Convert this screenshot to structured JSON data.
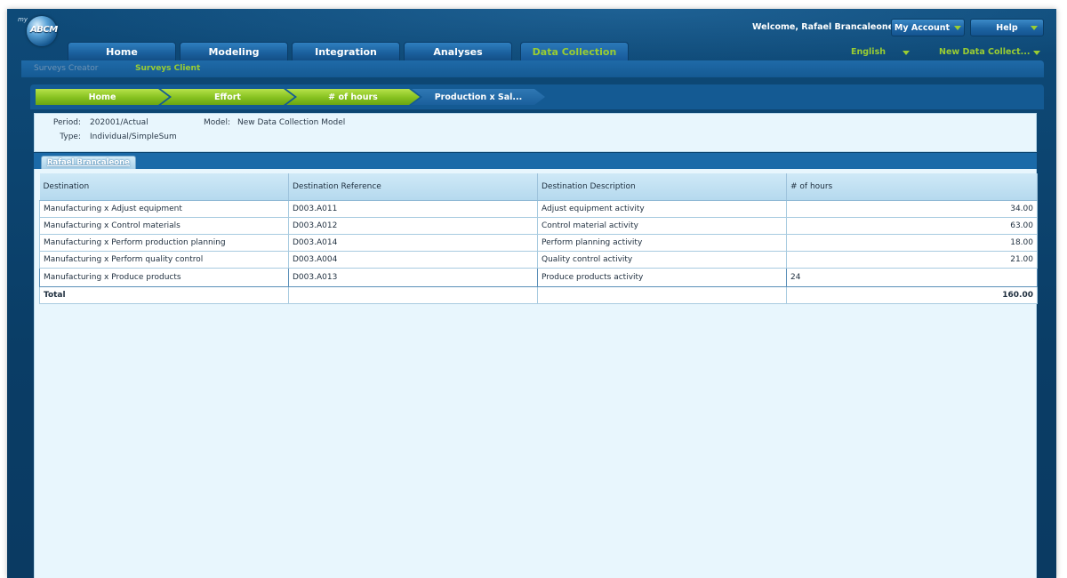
{
  "header": {
    "logo_prefix": "my",
    "logo_text": "ABCM",
    "welcome": "Welcome, Rafael Brancaleone",
    "my_account": "My Account",
    "help": "Help",
    "language": "English",
    "model_select": "New Data Collect..."
  },
  "nav": {
    "tabs": [
      "Home",
      "Modeling",
      "Integration",
      "Analyses",
      "Data Collection"
    ],
    "active": "Data Collection"
  },
  "subnav": {
    "items": [
      "Surveys Creator",
      "Surveys Client"
    ],
    "active": "Surveys Client"
  },
  "breadcrumb": [
    "Home",
    "Effort",
    "# of hours",
    "Production x Sal..."
  ],
  "info": {
    "period_label": "Period:",
    "period_value": "202001/Actual",
    "type_label": "Type:",
    "type_value": "Individual/SimpleSum",
    "model_label": "Model:",
    "model_value": "New Data Collection Model"
  },
  "person_tab": "Rafael Brancaleone",
  "table": {
    "columns": [
      "Destination",
      "Destination Reference",
      "Destination Description",
      "# of hours"
    ],
    "rows": [
      [
        "Manufacturing x Adjust equipment",
        "D003.A011",
        "Adjust equipment activity",
        "34.00"
      ],
      [
        "Manufacturing x Control materials",
        "D003.A012",
        "Control material activity",
        "63.00"
      ],
      [
        "Manufacturing x Perform production planning",
        "D003.A014",
        "Perform planning activity",
        "18.00"
      ],
      [
        "Manufacturing x Perform quality control",
        "D003.A004",
        "Quality control activity",
        "21.00"
      ],
      [
        "Manufacturing x Produce products",
        "D003.A013",
        "Produce products activity",
        "24"
      ]
    ],
    "total_label": "Total",
    "total_value": "160.00"
  },
  "colors": {
    "accent_green": "#9acd32",
    "nav_blue": "#1a5f9c",
    "panel_bg": "#e8f6fd"
  }
}
